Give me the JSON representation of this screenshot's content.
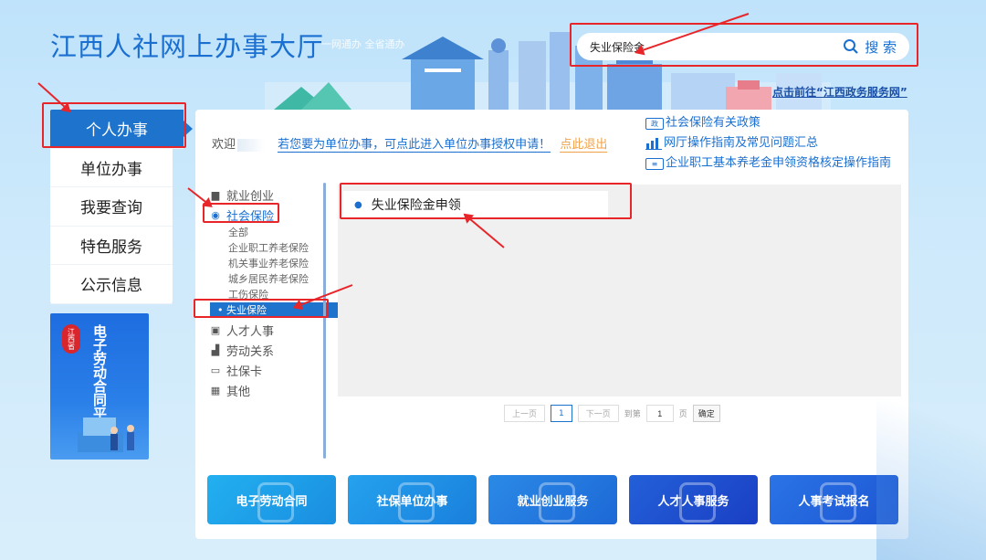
{
  "header": {
    "title": "江西人社网上办事大厅",
    "slogan": "一网通办 全省通办",
    "gov_link": "点击前往“江西政务服务网”"
  },
  "search": {
    "value": "失业保险金",
    "button_label": "搜 索"
  },
  "left_nav": {
    "items": [
      {
        "label": "个人办事"
      },
      {
        "label": "单位办事"
      },
      {
        "label": "我要查询"
      },
      {
        "label": "特色服务"
      },
      {
        "label": "公示信息"
      }
    ]
  },
  "promo": {
    "seal": "江西省",
    "text": "电子劳动合同平台"
  },
  "welcome": {
    "prefix": "欢迎",
    "unit_link": "若您要为单位办事，可点此进入单位办事授权申请！",
    "logout": "点此退出"
  },
  "policy_links": [
    {
      "icon": "policy",
      "label": "社会保险有关政策"
    },
    {
      "icon": "chart",
      "label": "网厅操作指南及常见问题汇总"
    },
    {
      "icon": "doc",
      "label": "企业职工基本养老金申领资格核定操作指南"
    }
  ],
  "categories": {
    "jiuye": "就业创业",
    "shebao": "社会保险",
    "subs": [
      "全部",
      "企业职工养老保险",
      "机关事业养老保险",
      "城乡居民养老保险",
      "工伤保险"
    ],
    "selected_sub": "失业保险",
    "rencai": "人才人事",
    "laodong": "劳动关系",
    "shebaoka": "社保卡",
    "qita": "其他"
  },
  "results": {
    "items": [
      "失业保险金申领"
    ]
  },
  "pager": {
    "prev": "上一页",
    "current": "1",
    "next": "下一页",
    "goto_label": "到第",
    "page_input": "1",
    "page_unit": "页",
    "confirm": "确定"
  },
  "tiles": [
    {
      "label": "电子劳动合同",
      "color": "#1aa0e8"
    },
    {
      "label": "社保单位办事",
      "color": "#1b8be0"
    },
    {
      "label": "就业创业服务",
      "color": "#2177de"
    },
    {
      "label": "人才人事服务",
      "color": "#1d4fd0"
    },
    {
      "label": "人事考试报名",
      "color": "#1e63de"
    }
  ],
  "colors": {
    "accent": "#1e73cc",
    "highlight_box": "#e8262a",
    "logout": "#f0a24a"
  }
}
